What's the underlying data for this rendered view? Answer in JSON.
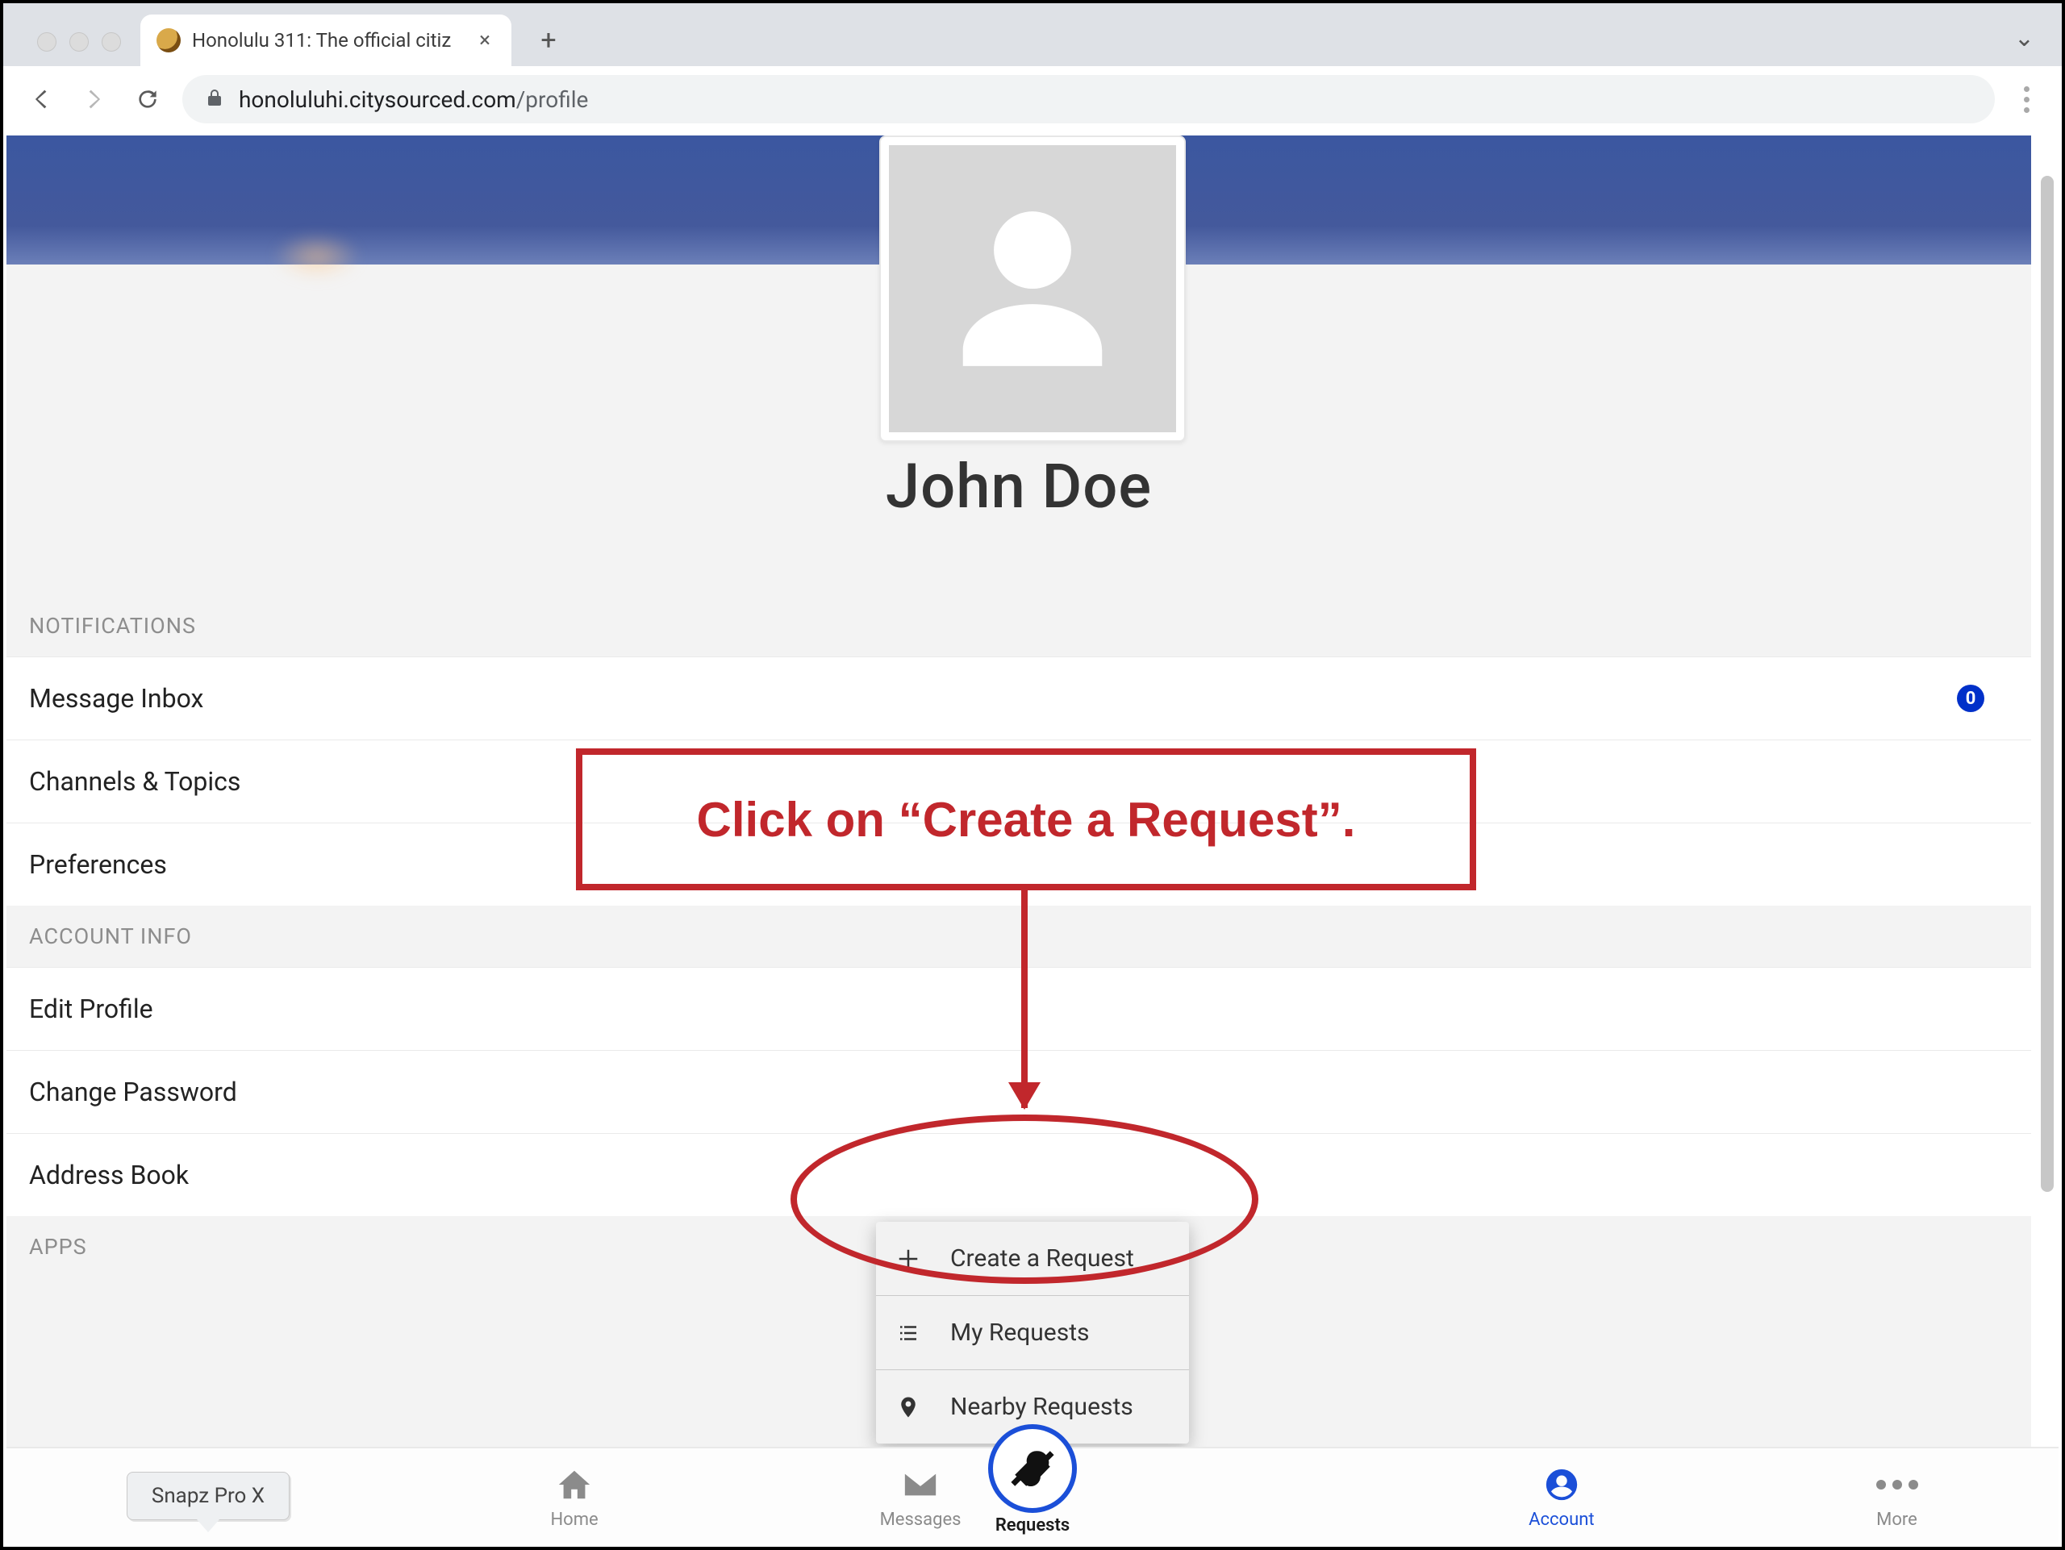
{
  "browser": {
    "tab_title": "Honolulu 311: The official citiz",
    "url_host": "honoluluhi.citysourced.com",
    "url_path": "/profile"
  },
  "profile": {
    "display_name": "John Doe"
  },
  "sections": {
    "notifications": {
      "label": "NOTIFICATIONS",
      "items": {
        "message_inbox": "Message Inbox",
        "message_inbox_badge": "0",
        "channels_topics": "Channels & Topics",
        "preferences": "Preferences"
      }
    },
    "account_info": {
      "label": "ACCOUNT INFO",
      "items": {
        "edit_profile": "Edit Profile",
        "change_password": "Change Password",
        "address_book": "Address Book"
      }
    },
    "apps": {
      "label": "APPS"
    }
  },
  "requests_menu": {
    "create": "Create a Request",
    "my": "My Requests",
    "nearby": "Nearby Requests"
  },
  "annotation": {
    "text": "Click on “Create a Request”."
  },
  "bottom_nav": {
    "home": "Home",
    "messages": "Messages",
    "requests": "Requests",
    "account": "Account",
    "more": "More"
  },
  "overlay": {
    "snapz": "Snapz Pro X"
  }
}
